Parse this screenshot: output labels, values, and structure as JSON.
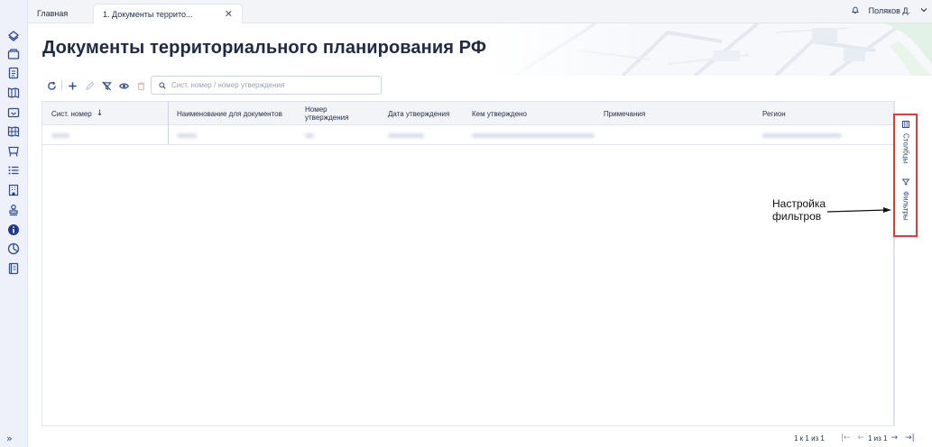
{
  "tabs": [
    {
      "label": "Главная"
    },
    {
      "label": "1. Документы террито..."
    }
  ],
  "user": {
    "name": "Поляков Д."
  },
  "page": {
    "title": "Документы территориального планирования РФ"
  },
  "search": {
    "placeholder": "Сист. номер / номер утверждения"
  },
  "table": {
    "columns": [
      {
        "label": "Сист. номер"
      },
      {
        "label": "Наименование для документов"
      },
      {
        "label": "Номер утверждения"
      },
      {
        "label": "Дата утверждения"
      },
      {
        "label": "Кем утверждено"
      },
      {
        "label": "Примечания"
      },
      {
        "label": "Регион"
      }
    ]
  },
  "right_panel": {
    "columns_label": "Столбцы",
    "filters_label": "Фильтры"
  },
  "annotation": {
    "line1": "Настройка",
    "line2": "фильтров"
  },
  "pagination": {
    "range": "1 к 1 из 1",
    "page": "1 из 1"
  },
  "colors": {
    "accent": "#2f4b9a",
    "highlight": "#e53935",
    "sidebar": "#eef1f9"
  },
  "icons": {
    "sidebar": [
      "layers-icon",
      "archive-icon",
      "document-icon",
      "map-book-icon",
      "inbox-icon",
      "map-icon",
      "easel-icon",
      "list-icon",
      "building-icon",
      "stamp-icon",
      "info-icon",
      "chart-icon",
      "register-icon"
    ],
    "toolbar": [
      "refresh-icon",
      "add-icon",
      "edit-icon",
      "clear-filter-icon",
      "view-icon",
      "delete-icon"
    ]
  }
}
